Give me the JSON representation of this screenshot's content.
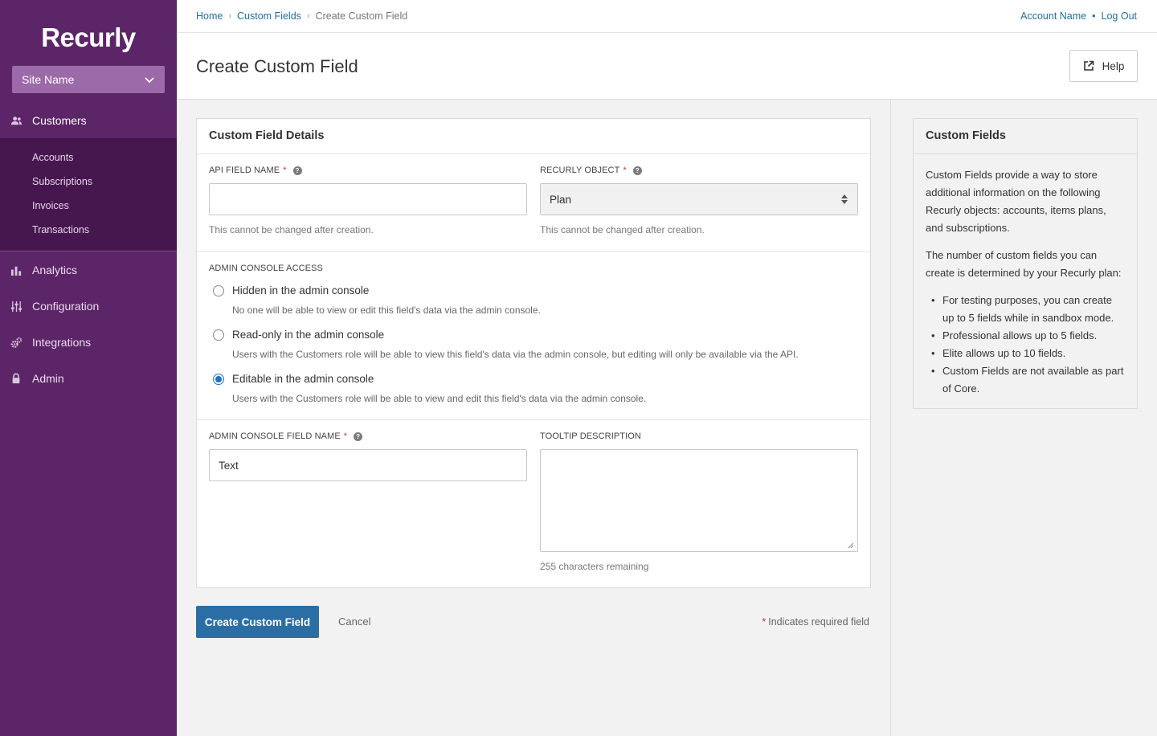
{
  "sidebar": {
    "logo": "Recurly",
    "site_name": "Site Name",
    "nav": {
      "customers": "Customers",
      "analytics": "Analytics",
      "configuration": "Configuration",
      "integrations": "Integrations",
      "admin": "Admin"
    },
    "subnav": {
      "accounts": "Accounts",
      "subscriptions": "Subscriptions",
      "invoices": "Invoices",
      "transactions": "Transactions"
    }
  },
  "topbar": {
    "breadcrumb": [
      "Home",
      "Custom Fields",
      "Create Custom Field"
    ],
    "account_name": "Account Name",
    "logout": "Log Out"
  },
  "header": {
    "title": "Create Custom Field",
    "help_label": "Help"
  },
  "form": {
    "card_title": "Custom Field Details",
    "api_field_name_label": "API FIELD NAME",
    "api_field_name_value": "",
    "api_field_name_help": "This cannot be changed after creation.",
    "recurly_object_label": "RECURLY OBJECT",
    "recurly_object_value": "Plan",
    "recurly_object_help": "This cannot be changed after creation.",
    "access_label": "ADMIN CONSOLE ACCESS",
    "access_options": [
      {
        "label": "Hidden in the admin console",
        "desc": "No one will be able to view or edit this field's data via the admin console.",
        "checked": false
      },
      {
        "label": "Read-only in the admin console",
        "desc": "Users with the Customers role will be able to view this field's data via the admin console, but editing will only be available via the API.",
        "checked": false
      },
      {
        "label": "Editable in the admin console",
        "desc": "Users with the Customers role will be able to view and edit this field's data via the admin console.",
        "checked": true
      }
    ],
    "console_name_label": "ADMIN CONSOLE FIELD NAME",
    "console_name_value": "Text",
    "tooltip_label": "TOOLTIP DESCRIPTION",
    "tooltip_value": "",
    "chars_remaining": "255 characters remaining",
    "required_star": "*",
    "help_glyph": "?"
  },
  "actions": {
    "create_label": "Create Custom Field",
    "cancel_label": "Cancel",
    "required_note": "Indicates required field"
  },
  "side": {
    "title": "Custom Fields",
    "para1": "Custom Fields provide a way to store additional information on the following Recurly objects: accounts, items plans, and subscriptions.",
    "para2": "The number of custom fields you can create is determined by your Recurly plan:",
    "bullets": [
      "For testing purposes, you can create up to 5 fields while in sandbox mode.",
      "Professional allows up to 5 fields.",
      "Elite allows up to 10 fields.",
      "Custom Fields are not available as part of Core."
    ]
  },
  "colors": {
    "sidebar_bg": "#5c2568",
    "subnav_bg": "#46174f",
    "primary": "#2b6ea6",
    "link": "#1f6fa6",
    "required": "#d0342c"
  }
}
